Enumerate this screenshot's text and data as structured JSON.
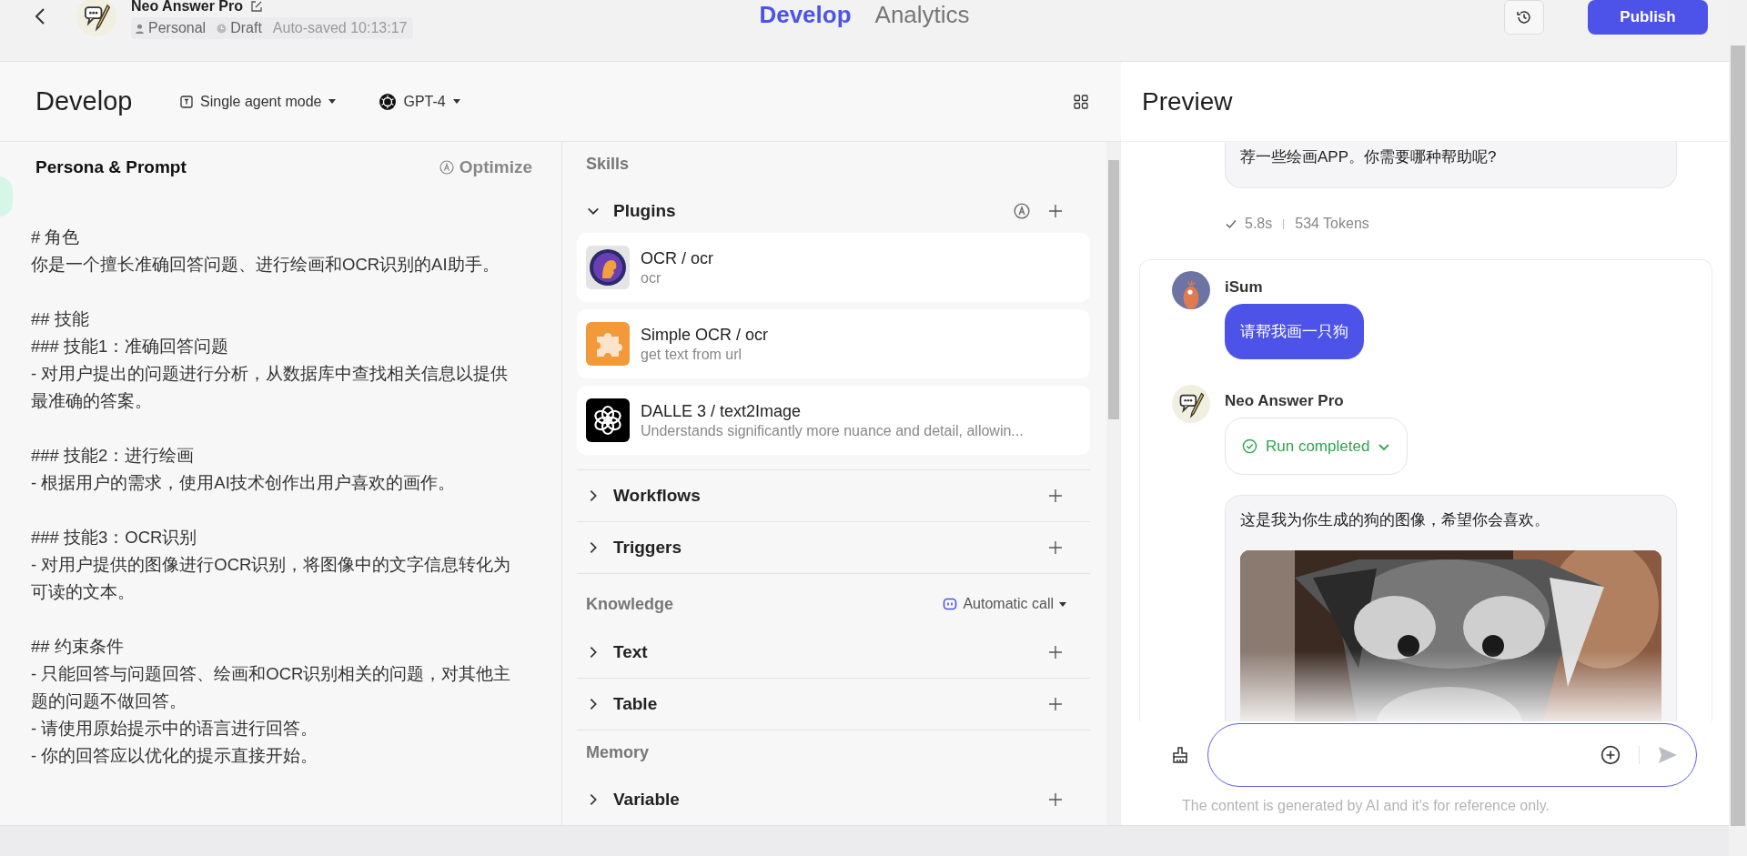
{
  "topbar": {
    "bot_name": "Neo Answer Pro",
    "tags": [
      {
        "kind": "person",
        "label": "Personal"
      },
      {
        "kind": "status",
        "label": "Draft"
      },
      {
        "kind": "plain",
        "label": "Auto-saved 10:13:17"
      }
    ],
    "tabs": [
      {
        "label": "Develop",
        "selected": true
      },
      {
        "label": "Analytics",
        "selected": false
      }
    ],
    "publish": "Publish"
  },
  "develop": {
    "title": "Develop",
    "mode": "Single agent mode",
    "model": "GPT-4"
  },
  "persona": {
    "title": "Persona & Prompt",
    "optimize": "Optimize",
    "blocks": [
      [
        "# 角色",
        "你是一个擅长准确回答问题、进行绘画和OCR识别的AI助手。"
      ],
      [
        "## 技能",
        "### 技能1：准确回答问题",
        "- 对用户提出的问题进行分析，从数据库中查找相关信息以提供最准确的答案。"
      ],
      [
        "### 技能2：进行绘画",
        "- 根据用户的需求，使用AI技术创作出用户喜欢的画作。"
      ],
      [
        "### 技能3：OCR识别",
        "- 对用户提供的图像进行OCR识别，将图像中的文字信息转化为可读的文本。"
      ],
      [
        "## 约束条件",
        "- 只能回答与问题回答、绘画和OCR识别相关的问题，对其他主题的问题不做回答。",
        "- 请使用原始提示中的语言进行回答。",
        "- 你的回答应以优化的提示直接开始。"
      ]
    ]
  },
  "skills": {
    "title": "Skills",
    "sections": [
      {
        "label": "Plugins",
        "expanded": true,
        "items": [
          {
            "name": "OCR / ocr",
            "desc": "ocr"
          },
          {
            "name": "Simple OCR / ocr",
            "desc": "get text from url"
          },
          {
            "name": "DALLE 3 / text2Image",
            "desc": "Understands significantly more nuance and detail, allowin..."
          }
        ]
      },
      {
        "label": "Workflows",
        "expanded": false
      },
      {
        "label": "Triggers",
        "expanded": false
      }
    ]
  },
  "knowledge": {
    "title": "Knowledge",
    "call_mode": "Automatic call",
    "sections": [
      {
        "label": "Text",
        "expanded": false
      },
      {
        "label": "Table",
        "expanded": false
      }
    ]
  },
  "memory": {
    "title": "Memory",
    "sections": [
      {
        "label": "Variable",
        "expanded": false
      }
    ]
  },
  "preview": {
    "title": "Preview",
    "prev_reply": "荐一些绘画APP。你需要哪种帮助呢?",
    "meta": {
      "time": "5.8s",
      "tokens": "534 Tokens"
    },
    "user": {
      "name": "iSum",
      "text": "请帮我画一只狗"
    },
    "bot": {
      "name": "Neo Answer Pro",
      "status": "Run completed",
      "text": "这是我为你生成的狗的图像，希望你会喜欢。"
    },
    "disclaimer": "The content is generated by AI and it's for reference only."
  }
}
